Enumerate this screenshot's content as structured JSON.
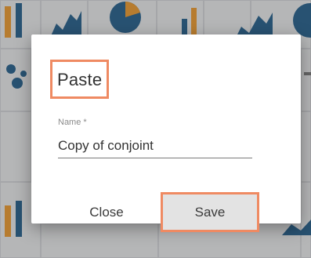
{
  "dialog": {
    "title": "Paste",
    "name_label": "Name *",
    "name_value": "Copy of conjoint",
    "close_label": "Close",
    "save_label": "Save"
  },
  "colors": {
    "highlight": "#ef8a62",
    "chart_blue": "#1f5d8c",
    "chart_orange": "#f29b2a"
  },
  "background_icons": [
    "bar-chart-icon",
    "area-chart-icon",
    "pie-chart-icon",
    "scatter-icon"
  ]
}
